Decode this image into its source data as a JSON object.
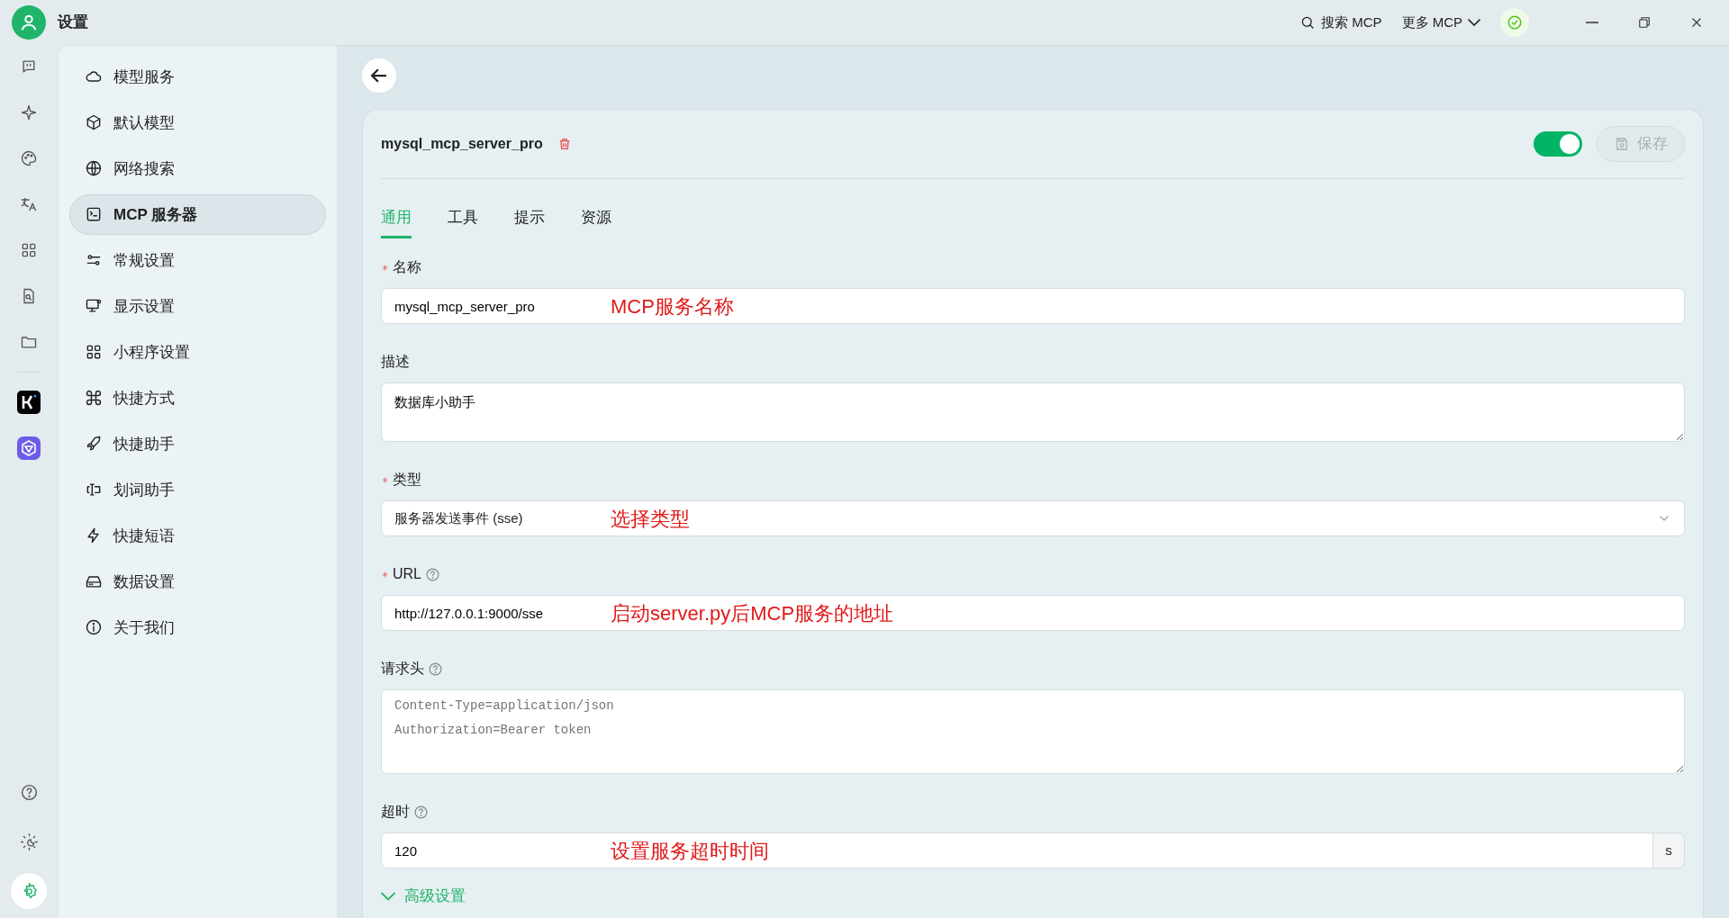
{
  "window": {
    "title": "设置"
  },
  "top_bar": {
    "search_label": "搜索 MCP",
    "more_label": "更多 MCP"
  },
  "rail": [
    {
      "selected": false
    },
    {
      "selected": false
    },
    {
      "selected": false
    },
    {
      "selected": false
    },
    {
      "selected": false
    },
    {
      "selected": false
    },
    {
      "selected": false
    }
  ],
  "rail_bottom": [
    {
      "selected": false
    },
    {
      "selected": false
    },
    {
      "selected": true
    }
  ],
  "sidebar": {
    "items": [
      {
        "label": "模型服务",
        "selected": false
      },
      {
        "label": "默认模型",
        "selected": false
      },
      {
        "label": "网络搜索",
        "selected": false
      },
      {
        "label": "MCP 服务器",
        "selected": true
      },
      {
        "label": "常规设置",
        "selected": false
      },
      {
        "label": "显示设置",
        "selected": false
      },
      {
        "label": "小程序设置",
        "selected": false
      },
      {
        "label": "快捷方式",
        "selected": false
      },
      {
        "label": "快捷助手",
        "selected": false
      },
      {
        "label": "划词助手",
        "selected": false
      },
      {
        "label": "快捷短语",
        "selected": false
      },
      {
        "label": "数据设置",
        "selected": false
      },
      {
        "label": "关于我们",
        "selected": false
      }
    ]
  },
  "server": {
    "name": "mysql_mcp_server_pro",
    "enabled": true,
    "save_label": "保存",
    "save_disabled": true
  },
  "tabs": [
    {
      "label": "通用",
      "selected": true
    },
    {
      "label": "工具",
      "selected": false
    },
    {
      "label": "提示",
      "selected": false
    },
    {
      "label": "资源",
      "selected": false
    }
  ],
  "fields": [
    {
      "kind": "text",
      "label": "名称",
      "required": true,
      "help": false,
      "value": "mysql_mcp_server_pro",
      "annotation": "MCP服务名称"
    },
    {
      "kind": "textarea",
      "label": "描述",
      "required": false,
      "help": false,
      "value": "数据库小助手"
    },
    {
      "kind": "select",
      "label": "类型",
      "required": true,
      "help": false,
      "value": "服务器发送事件 (sse)",
      "annotation": "选择类型"
    },
    {
      "kind": "text",
      "label": "URL",
      "required": true,
      "help": true,
      "value": "http://127.0.0.1:9000/sse",
      "annotation": "启动server.py后MCP服务的地址"
    },
    {
      "kind": "code",
      "label": "请求头",
      "required": false,
      "help": true,
      "placeholder": "Content-Type=application/json\nAuthorization=Bearer token"
    },
    {
      "kind": "number",
      "label": "超时",
      "required": false,
      "help": true,
      "value": "120",
      "suffix": "s",
      "annotation": "设置服务超时时间"
    }
  ],
  "advanced": {
    "label": "高级设置"
  }
}
